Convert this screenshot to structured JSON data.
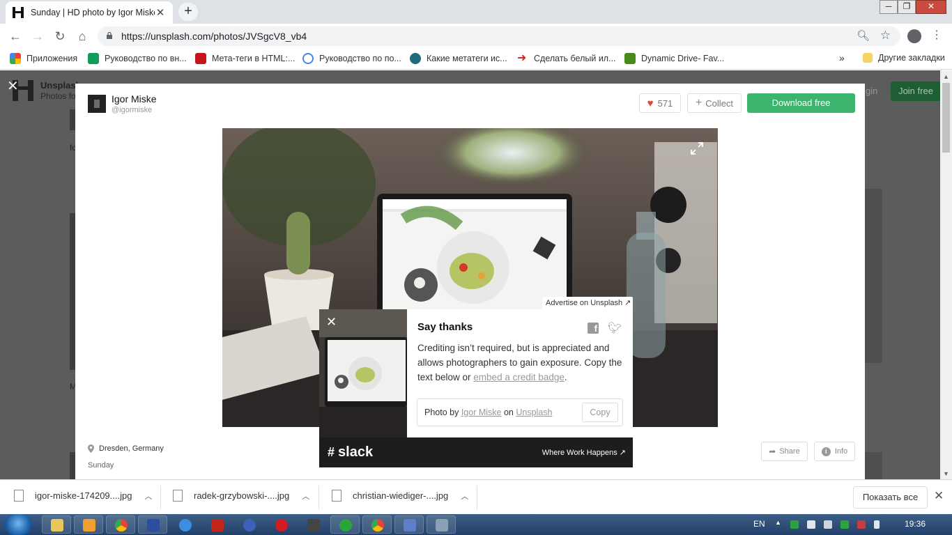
{
  "browser": {
    "tab_title": "Sunday | HD photo by Igor Miske",
    "tab_close": "✕",
    "new_tab": "+",
    "url": "https://unsplash.com/photos/JVSgcV8_vb4",
    "window_minimize": "─",
    "window_maximize": "❐",
    "window_close": "✕"
  },
  "bookmarks": {
    "items": [
      {
        "label": "Приложения",
        "color": "#e94235"
      },
      {
        "label": "Руководство по вн...",
        "color": "#0f9d58"
      },
      {
        "label": "Мета-теги в HTML:...",
        "color": "#c4161c"
      },
      {
        "label": "Руководство по по...",
        "color": "#4285f4"
      },
      {
        "label": "Какие метатеги ис...",
        "color": "#1e6b7b"
      },
      {
        "label": "Сделать белый ил...",
        "color": "#e02020"
      },
      {
        "label": "Dynamic Drive- Fav...",
        "color": "#4a8a1c"
      }
    ],
    "more": "»",
    "other": "Другие закладки"
  },
  "page_bg": {
    "brand": "Unsplash",
    "brand_sub": "Photos fo",
    "login": "gin",
    "join": "Join free",
    "frag1": "fo",
    "frag2": "M"
  },
  "modal": {
    "author_name": "Igor Miske",
    "author_handle": "@igormiske",
    "likes": "571",
    "collect_label": "Collect",
    "download_label": "Download free",
    "location": "Dresden, Germany",
    "photo_title": "Sunday",
    "share_label": "Share",
    "info_label": "Info"
  },
  "thanks": {
    "title": "Say thanks",
    "body_pre": "Crediting isn’t required, but is appreciated and allows photographers to gain exposure. Copy the text below or ",
    "body_link": "embed a credit badge",
    "body_post": ".",
    "credit_pre": "Photo by ",
    "credit_author": "Igor Miske",
    "credit_mid": " on ",
    "credit_site": "Unsplash",
    "copy_label": "Copy"
  },
  "ad": {
    "advertise": "Advertise on Unsplash ↗",
    "brand": "slack",
    "tagline": "Where Work Happens"
  },
  "downloads": {
    "files": [
      "igor-miske-174209....jpg",
      "radek-grzybowski-....jpg",
      "christian-wiediger-....jpg"
    ],
    "show_all": "Показать все"
  },
  "taskbar": {
    "lang": "EN",
    "time": "19:36"
  }
}
